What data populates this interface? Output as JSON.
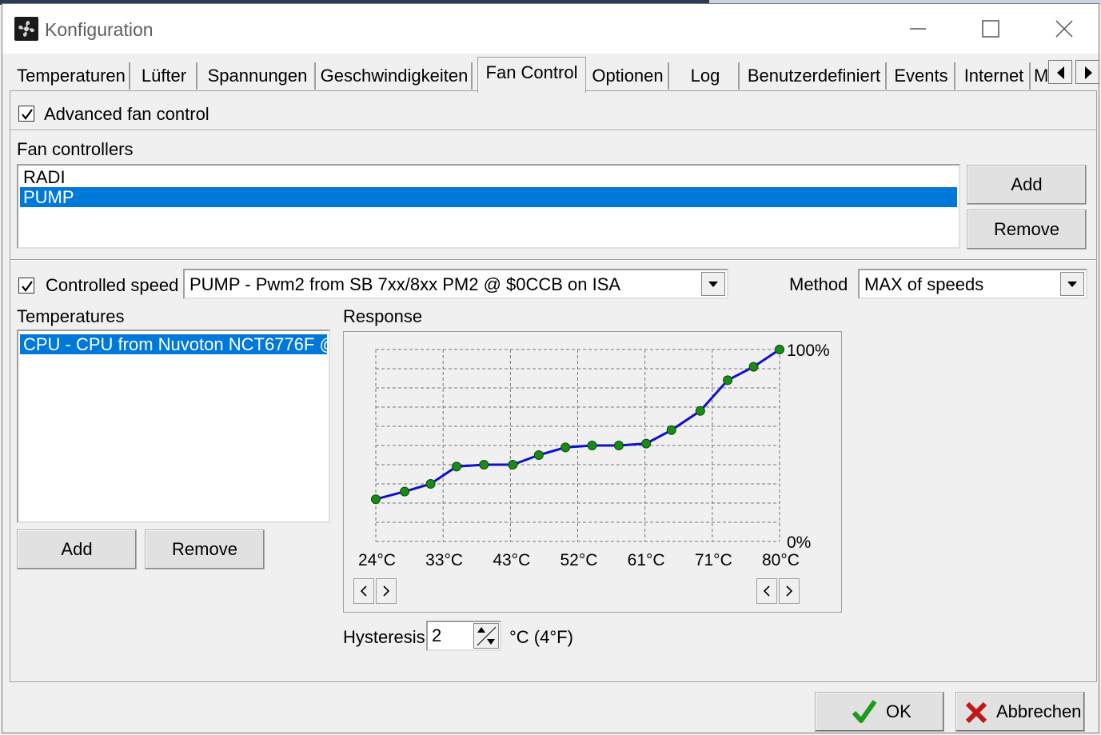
{
  "window": {
    "title": "Konfiguration",
    "controls": [
      "minimize-icon",
      "maximize-icon",
      "close-icon"
    ]
  },
  "tabs": [
    {
      "label": "Temperaturen"
    },
    {
      "label": "Lüfter"
    },
    {
      "label": "Spannungen"
    },
    {
      "label": "Geschwindigkeiten"
    },
    {
      "label": "Fan Control",
      "active": true
    },
    {
      "label": "Optionen"
    },
    {
      "label": "Log"
    },
    {
      "label": "Benutzerdefiniert"
    },
    {
      "label": "Events"
    },
    {
      "label": "Internet"
    },
    {
      "label": "M"
    }
  ],
  "fan_control": {
    "advanced_label": "Advanced fan control",
    "advanced_checked": true,
    "controllers_label": "Fan controllers",
    "controllers": [
      {
        "name": "RADI",
        "selected": false
      },
      {
        "name": "PUMP",
        "selected": true
      }
    ],
    "add_label": "Add",
    "remove_label": "Remove",
    "controlled_speed_label": "Controlled speed",
    "controlled_speed_checked": true,
    "controlled_speed_value": "PUMP - Pwm2 from SB 7xx/8xx PM2 @ $0CCB on ISA",
    "method_label": "Method",
    "method_value": "MAX of speeds",
    "temperatures_label": "Temperatures",
    "temperatures": [
      {
        "name": "CPU - CPU from Nuvoton NCT6776F @",
        "selected": true
      }
    ],
    "temp_add_label": "Add",
    "temp_remove_label": "Remove",
    "response_label": "Response",
    "hysteresis_label": "Hysteresis",
    "hysteresis_value": "2",
    "hysteresis_unit": "°C (4°F)"
  },
  "chart_data": {
    "type": "line",
    "title": "",
    "y_max_label": "100%",
    "y_min_label": "0%",
    "x_ticks": [
      "24°C",
      "33°C",
      "43°C",
      "52°C",
      "61°C",
      "71°C",
      "80°C"
    ],
    "xlim": [
      24,
      80
    ],
    "ylim": [
      0,
      100
    ],
    "grid": true,
    "line_color": "#1010cc",
    "point_color": "#1a8a1a",
    "points": [
      {
        "x": 24,
        "y": 22
      },
      {
        "x": 28,
        "y": 26
      },
      {
        "x": 31.6,
        "y": 30
      },
      {
        "x": 35.2,
        "y": 39
      },
      {
        "x": 39,
        "y": 40
      },
      {
        "x": 43,
        "y": 40
      },
      {
        "x": 46.6,
        "y": 45
      },
      {
        "x": 50.3,
        "y": 49
      },
      {
        "x": 54,
        "y": 50
      },
      {
        "x": 57.7,
        "y": 50
      },
      {
        "x": 61.5,
        "y": 51
      },
      {
        "x": 65,
        "y": 58
      },
      {
        "x": 69,
        "y": 68
      },
      {
        "x": 72.8,
        "y": 84
      },
      {
        "x": 76.4,
        "y": 91
      },
      {
        "x": 80,
        "y": 100
      }
    ]
  },
  "footer": {
    "ok_label": "OK",
    "cancel_label": "Abbrechen"
  }
}
